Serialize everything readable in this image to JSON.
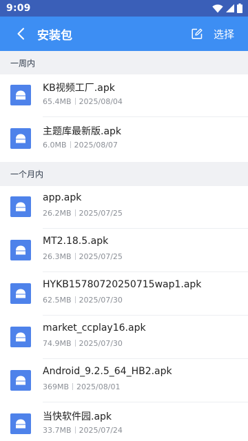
{
  "status": {
    "time": "9:09"
  },
  "header": {
    "title": "安装包",
    "select_label": "选择"
  },
  "sections": [
    {
      "label": "一周内",
      "items": [
        {
          "name": "KB视频工厂.apk",
          "size": "65.4MB",
          "date": "2025/08/04"
        },
        {
          "name": "主题库最新版.apk",
          "size": "6.0MB",
          "date": "2025/08/07"
        }
      ]
    },
    {
      "label": "一个月内",
      "items": [
        {
          "name": "app.apk",
          "size": "26.2MB",
          "date": "2025/07/25"
        },
        {
          "name": "MT2.18.5.apk",
          "size": "26.3MB",
          "date": "2025/07/25"
        },
        {
          "name": "HYKB15780720250715wap1.apk",
          "size": "62.5MB",
          "date": "2025/07/30"
        },
        {
          "name": "market_ccplay16.apk",
          "size": "74.9MB",
          "date": "2025/07/30"
        },
        {
          "name": "Android_9.2.5_64_HB2.apk",
          "size": "369MB",
          "date": "2025/08/01"
        },
        {
          "name": "当快软件园.apk",
          "size": "33.7MB",
          "date": "2025/07/24"
        }
      ]
    }
  ],
  "colors": {
    "accent": "#3d8ef3",
    "statusbar": "#3a5fb8",
    "file_icon": "#4e82ea"
  },
  "icons": {
    "back": "chevron-left-icon",
    "edit": "edit-icon",
    "file": "apk-file-icon",
    "wifi": "wifi-icon",
    "signal": "signal-icon",
    "battery": "battery-icon"
  }
}
